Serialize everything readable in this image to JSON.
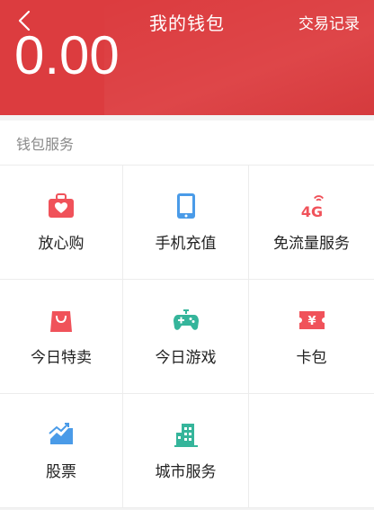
{
  "header": {
    "title": "我的钱包",
    "record_label": "交易记录",
    "balance": "0.00",
    "background_color": "#dc3c3f"
  },
  "section": {
    "title": "钱包服务"
  },
  "services": [
    {
      "label": "放心购",
      "icon": "briefcase-heart-icon",
      "color": "#f0525a"
    },
    {
      "label": "手机充值",
      "icon": "phone-icon",
      "color": "#4a9be8"
    },
    {
      "label": "免流量服务",
      "icon": "4g-icon",
      "color": "#f0525a",
      "icon_text": "4G"
    },
    {
      "label": "今日特卖",
      "icon": "shopping-bag-icon",
      "color": "#f0525a"
    },
    {
      "label": "今日游戏",
      "icon": "gamepad-icon",
      "color": "#35b59b"
    },
    {
      "label": "卡包",
      "icon": "ticket-icon",
      "color": "#f0525a",
      "icon_text": "¥"
    },
    {
      "label": "股票",
      "icon": "stock-chart-icon",
      "color": "#4a9be8"
    },
    {
      "label": "城市服务",
      "icon": "building-icon",
      "color": "#35b59b"
    }
  ]
}
